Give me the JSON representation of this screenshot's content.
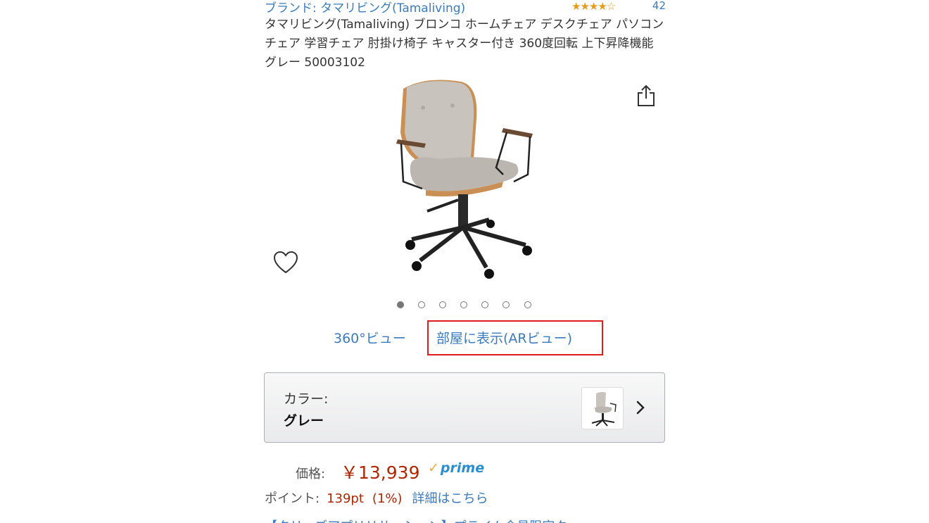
{
  "brand": {
    "label": "ブランド: タマリビング(Tamaliving)",
    "rating_stars": "★★★★☆",
    "rating_count": "42"
  },
  "product": {
    "title": "タマリビング(Tamaliving) ブロンコ ホームチェア デスクチェア パソコンチェア 学習チェア 肘掛け椅子 キャスター付き 360度回転 上下昇降機能 グレー 50003102"
  },
  "gallery": {
    "image_count": 7,
    "active_index": 0
  },
  "views": {
    "view360_label": "360°ビュー",
    "ar_label": "部屋に表示(ARビュー)"
  },
  "color": {
    "label": "カラー:",
    "value": "グレー"
  },
  "price": {
    "label": "価格:",
    "value": "￥13,939",
    "prime": "prime"
  },
  "points": {
    "label": "ポイント:",
    "value": "139pt",
    "percent": "(1%)",
    "details_link": "詳細はこちら"
  },
  "partial_row": "【タリーズアプリリサーション】プライム会員限定ク",
  "colors": {
    "link": "#3b7bbf",
    "price": "#b12704",
    "highlight_box": "#e01c1c",
    "stars": "#e89a18"
  }
}
